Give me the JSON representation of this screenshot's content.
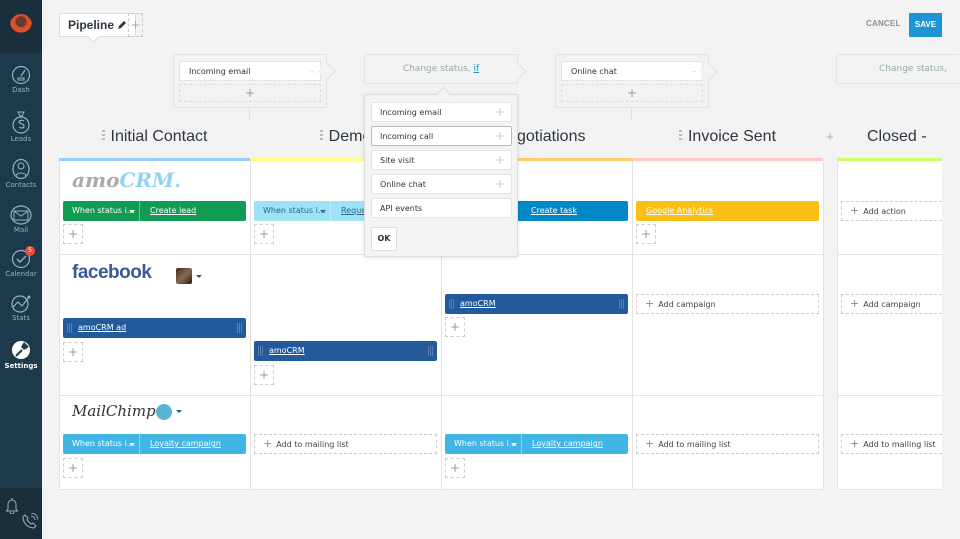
{
  "sidebar": {
    "items": [
      {
        "label": "Dash",
        "icon": "dashboard-icon"
      },
      {
        "label": "Leads",
        "icon": "dollar-icon"
      },
      {
        "label": "Contacts",
        "icon": "contacts-icon"
      },
      {
        "label": "Mail",
        "icon": "mail-icon"
      },
      {
        "label": "Calendar",
        "icon": "calendar-check-icon",
        "badge": "5"
      },
      {
        "label": "Stats",
        "icon": "stats-icon"
      },
      {
        "label": "Settings",
        "icon": "wrench-icon",
        "active": true
      }
    ]
  },
  "header": {
    "pipeline_label": "Pipeline",
    "add_label": "+",
    "cancel_label": "CANCEL",
    "save_label": "SAVE"
  },
  "triggers": {
    "initial": {
      "value": "Incoming email",
      "minus": "–",
      "add": "+"
    },
    "demo": {
      "text": "Change status, ",
      "link": "if"
    },
    "negotiations": {
      "value": "Online chat",
      "minus": "–",
      "add": "+"
    },
    "closed": {
      "text": "Change status,"
    }
  },
  "columns": [
    {
      "name": "Initial Contact",
      "color": "#99ccff"
    },
    {
      "name": "Demo",
      "color": "#fffd7f"
    },
    {
      "name": "Negotiations",
      "color": "#ffcc66"
    },
    {
      "name": "Invoice Sent",
      "color": "#ffc8c8"
    },
    {
      "name": "Closed -",
      "color": "#ccff66"
    }
  ],
  "add_column_label": "+",
  "rows": {
    "amocrm": {
      "logo_a": "amo",
      "logo_b": "CRM.",
      "cells": [
        {
          "cond": "When status i...",
          "action": "Create lead"
        },
        {
          "cond": "When status i...",
          "action": "Request"
        },
        {
          "action": "Create task"
        },
        {
          "action": "Google Analytics"
        },
        {
          "add": "Add action"
        }
      ]
    },
    "facebook": {
      "logo": "facebook",
      "cells": [
        {
          "action": "amoCRM ad"
        },
        {
          "action": "amoCRM"
        },
        {
          "action": "amoCRM"
        },
        {
          "add": "Add campaign"
        },
        {
          "add": "Add campaign"
        }
      ]
    },
    "mailchimp": {
      "logo": "MailChimp",
      "cells": [
        {
          "cond": "When status i...",
          "action": "Loyalty campaign"
        },
        {
          "add": "Add to mailing list"
        },
        {
          "cond": "When status i...",
          "action": "Loyalty campaign"
        },
        {
          "add": "Add to mailing list"
        },
        {
          "add": "Add to mailing list"
        }
      ]
    }
  },
  "plus": "+",
  "popup": {
    "items": [
      "Incoming email",
      "Incoming call",
      "Site visit",
      "Online chat",
      "API events"
    ],
    "ok_label": "OK"
  }
}
